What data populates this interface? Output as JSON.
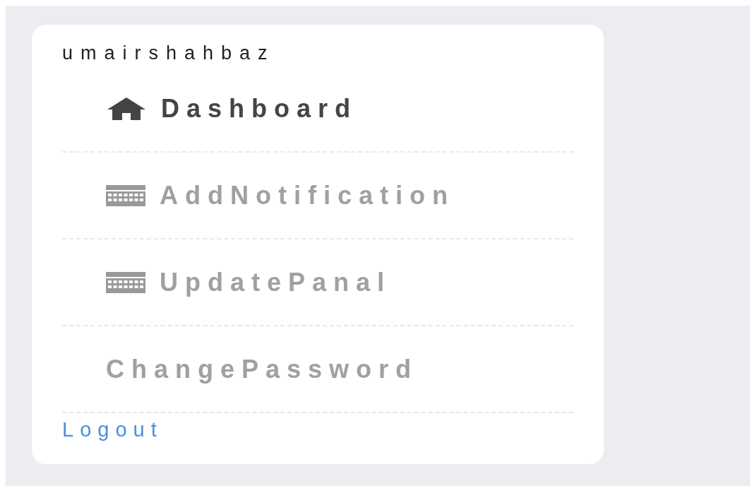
{
  "user": {
    "name": "umairshahbaz"
  },
  "menu": [
    {
      "label": "Dashboard",
      "kind": "home",
      "selected": true
    },
    {
      "label": "AddNotification",
      "kind": "calendar",
      "selected": false
    },
    {
      "label": "UpdatePanal",
      "kind": "calendar",
      "selected": false
    },
    {
      "label": "ChangePassword",
      "kind": "plain",
      "selected": false
    }
  ],
  "logout": "Logout"
}
